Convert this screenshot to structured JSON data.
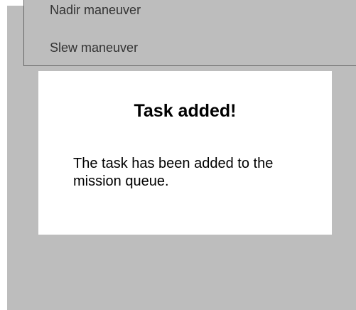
{
  "dropdown": {
    "items": [
      {
        "label": "Nadir maneuver"
      },
      {
        "label": "Slew maneuver"
      }
    ]
  },
  "dialog": {
    "title": "Task added!",
    "message": "The task has been added to the mission queue."
  },
  "colors": {
    "overlay": "#bdbdbd",
    "dialog_background": "#ffffff",
    "list_border": "#666666"
  }
}
